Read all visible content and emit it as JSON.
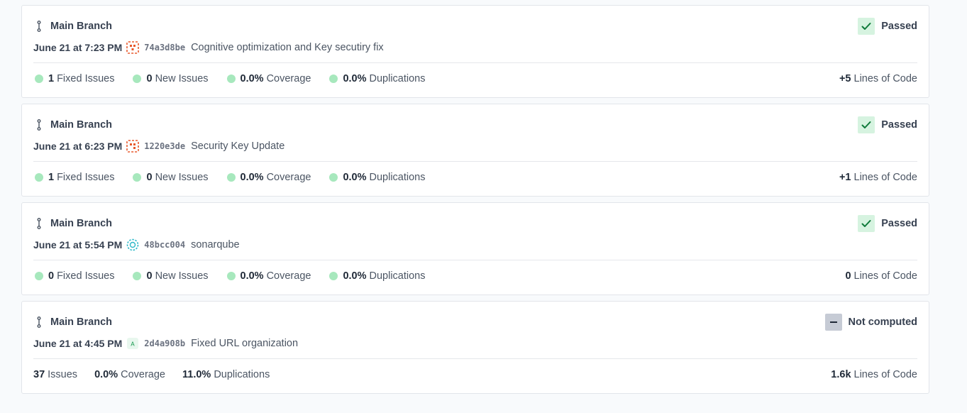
{
  "colors": {
    "passed_bg": "#d6f3e0",
    "check": "#0f7a3a",
    "metric_dot": "#a7e8bd",
    "not_computed_bg": "#c6cbd5"
  },
  "analyses": [
    {
      "branch": "Main Branch",
      "branch_icon": "branch-icon",
      "status": "Passed",
      "status_type": "passed",
      "date": "June 21 at 7:23 PM",
      "avatar_icon": "identicon-orange-icon",
      "avatar_color": "#e8582b",
      "hash": "74a3d8be",
      "message": "Cognitive optimization and Key secutiry fix",
      "fixed_issues": "1",
      "fixed_issues_label": "Fixed Issues",
      "new_issues": "0",
      "new_issues_label": "New Issues",
      "coverage": "0.0%",
      "coverage_label": "Coverage",
      "duplications": "0.0%",
      "duplications_label": "Duplications",
      "loc": "+5",
      "loc_label": "Lines of Code"
    },
    {
      "branch": "Main Branch",
      "branch_icon": "branch-icon",
      "status": "Passed",
      "status_type": "passed",
      "date": "June 21 at 6:23 PM",
      "avatar_icon": "identicon-orange-icon",
      "avatar_color": "#e8582b",
      "hash": "1220e3de",
      "message": "Security Key Update",
      "fixed_issues": "1",
      "fixed_issues_label": "Fixed Issues",
      "new_issues": "0",
      "new_issues_label": "New Issues",
      "coverage": "0.0%",
      "coverage_label": "Coverage",
      "duplications": "0.0%",
      "duplications_label": "Duplications",
      "loc": "+1",
      "loc_label": "Lines of Code"
    },
    {
      "branch": "Main Branch",
      "branch_icon": "branch-icon",
      "status": "Passed",
      "status_type": "passed",
      "date": "June 21 at 5:54 PM",
      "avatar_icon": "identicon-teal-icon",
      "avatar_color": "#2bb8c8",
      "hash": "48bcc004",
      "message": "sonarqube",
      "fixed_issues": "0",
      "fixed_issues_label": "Fixed Issues",
      "new_issues": "0",
      "new_issues_label": "New Issues",
      "coverage": "0.0%",
      "coverage_label": "Coverage",
      "duplications": "0.0%",
      "duplications_label": "Duplications",
      "loc": "0",
      "loc_label": "Lines of Code"
    },
    {
      "branch": "Main Branch",
      "branch_icon": "branch-icon",
      "status": "Not computed",
      "status_type": "na",
      "date": "June 21 at 4:45 PM",
      "avatar_icon": "letter-avatar-icon",
      "avatar_letter": "A",
      "avatar_color": "#1f9d55",
      "hash": "2d4a908b",
      "message": "Fixed URL organization",
      "issues": "37",
      "issues_label": "Issues",
      "coverage": "0.0%",
      "coverage_label": "Coverage",
      "duplications": "11.0%",
      "duplications_label": "Duplications",
      "loc": "1.6k",
      "loc_label": "Lines of Code"
    }
  ]
}
